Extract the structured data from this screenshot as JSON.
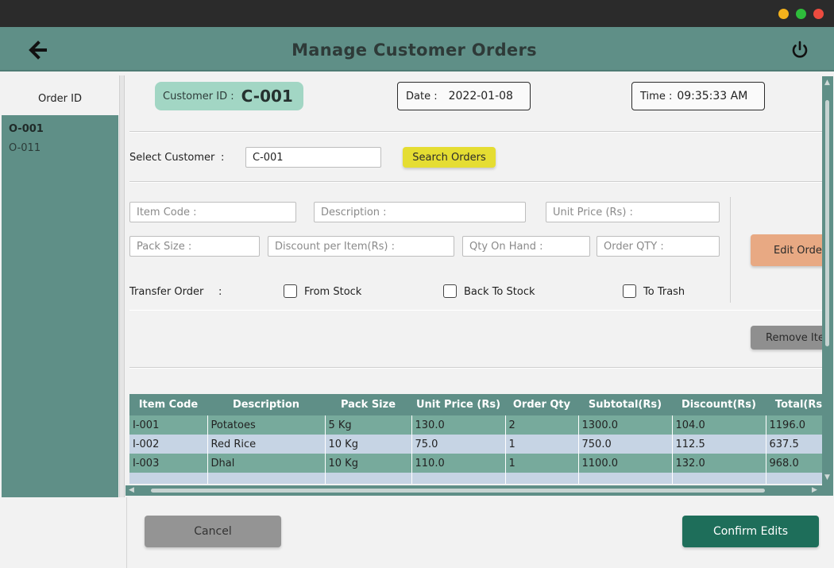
{
  "header": {
    "title": "Manage Customer Orders"
  },
  "sidebar": {
    "heading": "Order ID",
    "orders": [
      "O-001",
      "O-011"
    ]
  },
  "info": {
    "customer_label": "Customer ID :",
    "customer_value": "C-001",
    "date_label": "Date :",
    "date_value": "2022-01-08",
    "time_label": "Time :",
    "time_value": "09:35:33 AM"
  },
  "search": {
    "label": "Select Customer",
    "colon": ":",
    "value": "C-001",
    "button": "Search Orders"
  },
  "fields": {
    "item_code": "Item Code :",
    "description": "Description :",
    "unit_price": "Unit Price (Rs) :",
    "pack_size": "Pack Size :",
    "discount": "Discount per Item(Rs) :",
    "qty_on_hand": "Qty On Hand :",
    "order_qty": "Order QTY :"
  },
  "transfer": {
    "label": "Transfer Order",
    "colon": ":",
    "from_stock": "From Stock",
    "back_to_stock": "Back To Stock",
    "to_trash": "To Trash"
  },
  "actions": {
    "edit": "Edit Order",
    "remove": "Remove Item"
  },
  "table": {
    "headers": [
      "Item Code",
      "Description",
      "Pack Size",
      "Unit Price (Rs)",
      "Order Qty",
      "Subtotal(Rs)",
      "Discount(Rs)",
      "Total(Rs)"
    ],
    "rows": [
      [
        "I-001",
        "Potatoes",
        "5 Kg",
        "130.0",
        "2",
        "1300.0",
        "104.0",
        "1196.0"
      ],
      [
        "I-002",
        "Red Rice",
        "10 Kg",
        "75.0",
        "1",
        "750.0",
        "112.5",
        "637.5"
      ],
      [
        "I-003",
        "Dhal",
        "10 Kg",
        "110.0",
        "1",
        "1100.0",
        "132.0",
        "968.0"
      ],
      [
        "",
        "",
        "",
        "",
        "",
        "",
        "",
        ""
      ]
    ]
  },
  "footer": {
    "cancel": "Cancel",
    "confirm": "Confirm Edits"
  },
  "colors": {
    "accent": "#5f8f87",
    "confirm": "#1e6e5a",
    "search": "#e5dd32",
    "edit": "#e8a983"
  },
  "icons": {
    "back": "arrow-left-icon",
    "power": "power-icon"
  }
}
